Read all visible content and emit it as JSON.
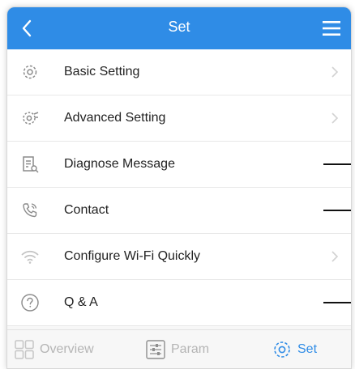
{
  "header": {
    "title": "Set",
    "back_icon": "chevron-left-icon",
    "menu_icon": "hamburger-menu-icon"
  },
  "colors": {
    "accent": "#2f8ce6",
    "text": "#222222",
    "muted": "#b5b5b5",
    "icon": "#8a8a8a"
  },
  "menu": {
    "items": [
      {
        "label": "Basic Setting",
        "icon": "gear-icon"
      },
      {
        "label": "Advanced Setting",
        "icon": "advanced-gear-icon"
      },
      {
        "label": "Diagnose Message",
        "icon": "document-search-icon"
      },
      {
        "label": "Contact",
        "icon": "phone-icon"
      },
      {
        "label": "Configure Wi-Fi Quickly",
        "icon": "wifi-icon"
      },
      {
        "label": "Q & A",
        "icon": "question-circle-icon"
      }
    ]
  },
  "tabbar": {
    "tabs": [
      {
        "label": "Overview",
        "icon": "grid-icon",
        "active": false
      },
      {
        "label": "Param",
        "icon": "sliders-icon",
        "active": false
      },
      {
        "label": "Set",
        "icon": "gear-icon",
        "active": true
      }
    ]
  }
}
